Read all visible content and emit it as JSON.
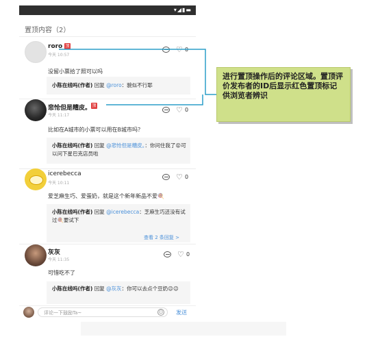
{
  "header": {
    "section_title": "置顶内容（2）"
  },
  "comments": [
    {
      "name": "roro",
      "time": "今天 10:57",
      "pinned_badge": "顶",
      "like_count": "0",
      "text": "没留小票拾了照可以吗",
      "reply": {
        "author": "小陈在线吗(作者)",
        "verb": " 回复 ",
        "mention": "@roro",
        "body": "：貌似不行耶"
      }
    },
    {
      "name": "悲怆但是糟皮。",
      "time": "今天 11:17",
      "pinned_badge": "顶",
      "like_count": "0",
      "text": "比如在A城市的小票可以用在B城市吗？",
      "reply": {
        "author": "小陈在线吗(作者)",
        "verb": " 回复 ",
        "mention": "@悲怆但是糟皮。",
        "body": "：你问住我了😝可以问下星巴克店员啦"
      }
    },
    {
      "name": "icerebecca",
      "time": "今天 10:11",
      "like_count": "0",
      "text": "爱芝麻生巧、爱蛋奶，就是这个新年新品不爱🍭",
      "reply": {
        "author": "小陈在线吗(作者)",
        "verb": " 回复 ",
        "mention": "@icerebecca",
        "body": "：芝麻生巧还没有试过🍭要试下"
      },
      "more_replies": "查看 2 条回复 >"
    },
    {
      "name": "灰灰",
      "time": "今天 11:35",
      "like_count": "0",
      "text": "可惜吃不了",
      "reply": {
        "author": "小陈在线吗(作者)",
        "verb": " 回复 ",
        "mention": "@灰灰",
        "body": "：你可以去点个豆奶😉😉"
      }
    }
  ],
  "input": {
    "placeholder": "评论一下鼓励Ta~",
    "send_label": "发送"
  },
  "callout": {
    "text": "进行置顶操作后的评论区域。置顶评价发布者的ID后显示红色置顶标记供浏览者辨识"
  },
  "colors": {
    "callout_bg": "#cfe08a",
    "connector": "#2a9ec8",
    "pin_badge": "#e03b3b",
    "link": "#4a90d9"
  }
}
